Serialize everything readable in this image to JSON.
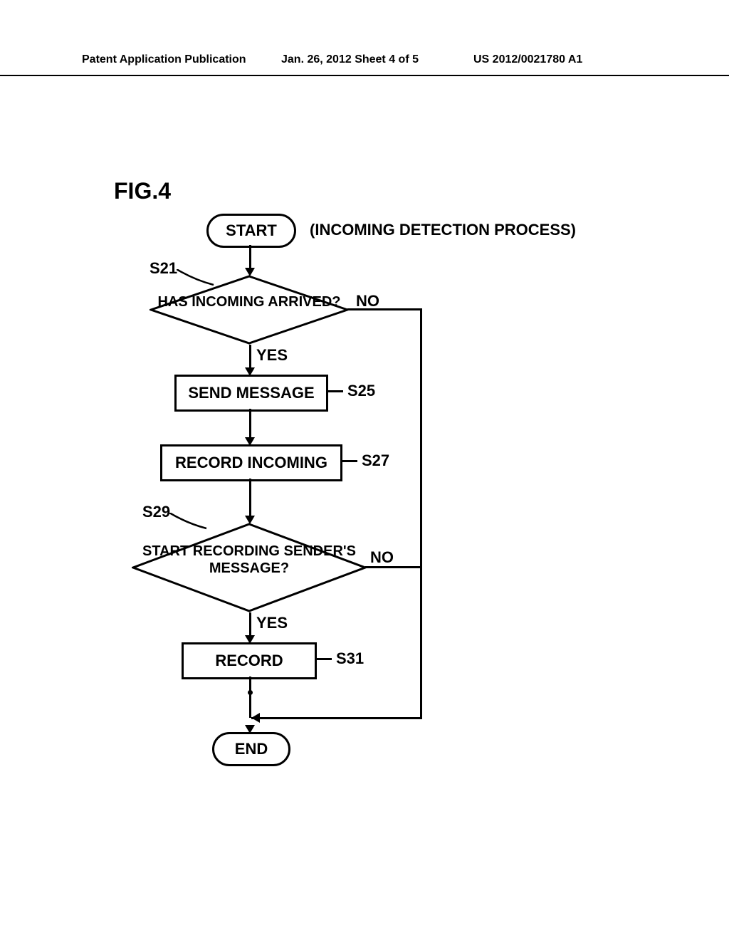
{
  "header": {
    "left": "Patent Application Publication",
    "center": "Jan. 26, 2012  Sheet 4 of 5",
    "right": "US 2012/0021780 A1"
  },
  "figure_label": "FIG.4",
  "subtitle": "(INCOMING DETECTION PROCESS)",
  "nodes": {
    "start": "START",
    "end": "END",
    "d1": "HAS INCOMING ARRIVED?",
    "p1": "SEND MESSAGE",
    "p2": "RECORD INCOMING",
    "d2": "START RECORDING SENDER'S MESSAGE?",
    "p3": "RECORD"
  },
  "step_labels": {
    "s21": "S21",
    "s25": "S25",
    "s27": "S27",
    "s29": "S29",
    "s31": "S31"
  },
  "branch_labels": {
    "yes": "YES",
    "no": "NO"
  }
}
